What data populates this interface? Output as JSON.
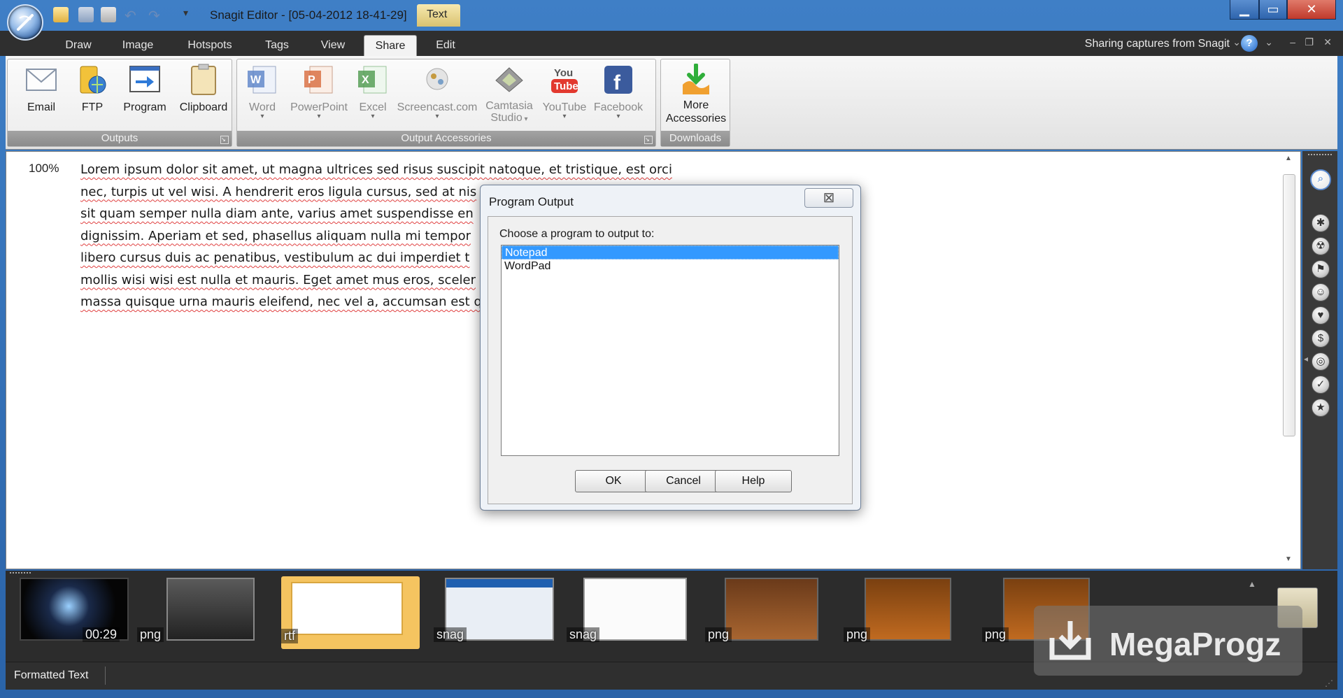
{
  "title_bar": {
    "title": "Snagit Editor - [05-04-2012 18-41-29]",
    "context_tab": "Text",
    "window_controls": [
      "minimize-icon",
      "maximize-icon",
      "close-icon"
    ]
  },
  "tabs": [
    {
      "label": "Draw"
    },
    {
      "label": "Image"
    },
    {
      "label": "Hotspots"
    },
    {
      "label": "Tags"
    },
    {
      "label": "View"
    },
    {
      "label": "Share",
      "active": true
    },
    {
      "label": "Edit"
    }
  ],
  "tab_row_right": {
    "status": "Sharing captures from Snagit",
    "help": "?"
  },
  "ribbon": {
    "outputs": {
      "label": "Outputs",
      "buttons": [
        {
          "label": "Email",
          "icon": "email-icon"
        },
        {
          "label": "FTP",
          "icon": "ftp-icon"
        },
        {
          "label": "Program",
          "icon": "program-icon"
        },
        {
          "label": "Clipboard",
          "icon": "clipboard-icon"
        }
      ]
    },
    "accessories": {
      "label": "Output Accessories",
      "buttons": [
        {
          "label": "Word",
          "icon": "word-icon"
        },
        {
          "label": "PowerPoint",
          "icon": "powerpoint-icon"
        },
        {
          "label": "Excel",
          "icon": "excel-icon"
        },
        {
          "label": "Screencast.com",
          "icon": "screencast-icon"
        },
        {
          "label": "Camtasia",
          "label2": "Studio",
          "icon": "camtasia-icon"
        },
        {
          "label": "YouTube",
          "icon": "youtube-icon"
        },
        {
          "label": "Facebook",
          "icon": "facebook-icon"
        }
      ]
    },
    "downloads": {
      "label": "Downloads",
      "button": {
        "label": "More",
        "label2": "Accessories",
        "icon": "download-accessories-icon"
      }
    }
  },
  "canvas": {
    "zoom": "100%",
    "lines": [
      "Lorem ipsum dolor sit amet, ut magna ultrices sed risus suscipit natoque, et tristique, est orci",
      "nec, turpis ut vel wisi. A hendrerit eros ligula cursus, sed at nis",
      "sit quam semper nulla diam ante, varius amet suspendisse en",
      "dignissim. Aperiam et sed, phasellus aliquam nulla mi tempor",
      "libero cursus duis ac penatibus, vestibulum ac dui imperdiet t",
      "mollis wisi wisi est nulla et mauris. Eget amet mus eros, sceler",
      "massa quisque urna mauris eleifend, nec vel a, accumsan est q"
    ]
  },
  "dialog": {
    "title": "Program Output",
    "prompt": "Choose a program to output to:",
    "items": [
      {
        "label": "Notepad",
        "selected": true
      },
      {
        "label": "WordPad",
        "selected": false
      }
    ],
    "buttons": {
      "ok": "OK",
      "cancel": "Cancel",
      "help": "Help"
    }
  },
  "tray": {
    "thumbnails": [
      {
        "label": "00:29",
        "kind": "video"
      },
      {
        "label": "png",
        "kind": "image"
      },
      {
        "label": "rtf",
        "kind": "text",
        "selected": true
      },
      {
        "label": "snag",
        "kind": "snag"
      },
      {
        "label": "snag",
        "kind": "snag"
      },
      {
        "label": "png",
        "kind": "image"
      },
      {
        "label": "png",
        "kind": "image"
      },
      {
        "label": "png",
        "kind": "image"
      }
    ]
  },
  "status_bar": {
    "text": "Formatted Text"
  },
  "watermark": {
    "text": "MegaProgz"
  },
  "colors": {
    "accent": "#3399ff",
    "tray": "#2c2c2c",
    "ribbon_group": "#8b8b8b"
  }
}
